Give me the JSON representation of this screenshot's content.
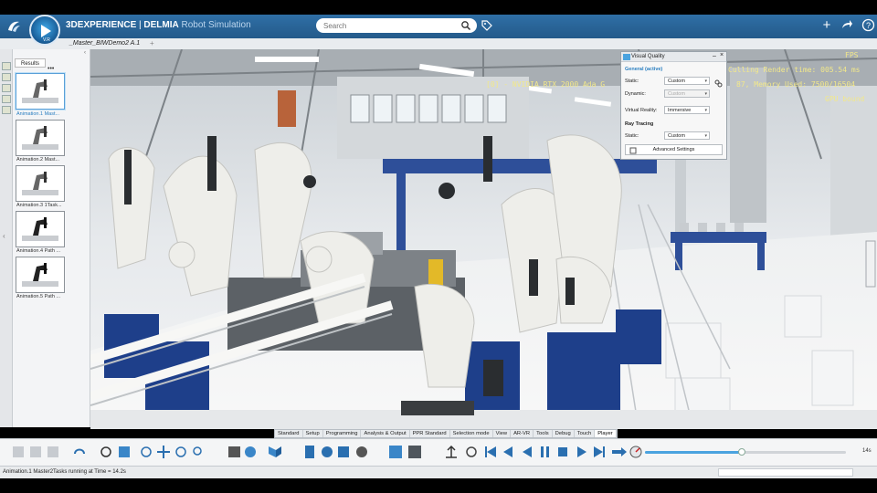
{
  "app": {
    "brand_bold": "3DEXPERIENCE",
    "brand_sep": " | ",
    "brand_product": "DELMIA",
    "brand_app": " Robot Simulation",
    "compass_version": "V.R"
  },
  "search": {
    "placeholder": "Search"
  },
  "document_tab": {
    "label": "_Master_BIWDemo2 A.1"
  },
  "results_panel": {
    "tab_label": "Results",
    "items": [
      {
        "label": "Animation.1 Mast..."
      },
      {
        "label": "Animation.2 Mast..."
      },
      {
        "label": "Animation.3 1Task..."
      },
      {
        "label": "Animation.4 Path ..."
      },
      {
        "label": "Animation.5 Path ..."
      }
    ]
  },
  "visual_quality": {
    "title": "Visual Quality",
    "general_label": "General (active)",
    "static_label": "Static:",
    "static_value": "Custom",
    "dynamic_label": "Dynamic:",
    "dynamic_value": "Custom",
    "vr_label": "Virtual Reality:",
    "vr_value": "Immersive",
    "ray_tracing_label": "Ray Tracing",
    "rt_static_label": "Static:",
    "rt_static_value": "Custom",
    "advanced_button": "Advanced Settings"
  },
  "overlay": {
    "fps": "FPS",
    "culling": "Culling Render time: 005.54 ms",
    "gpu": "[0] - NVIDIA RTX 2000 Ada G",
    "memory": "87, Memory Used: 7500/16504",
    "bound": "GPU bound"
  },
  "section_tabs": [
    {
      "label": "Standard"
    },
    {
      "label": "Setup"
    },
    {
      "label": "Programming"
    },
    {
      "label": "Analysis & Output"
    },
    {
      "label": "PPR Standard"
    },
    {
      "label": "Selection mode"
    },
    {
      "label": "View"
    },
    {
      "label": "AR-VR"
    },
    {
      "label": "Tools"
    },
    {
      "label": "Debug"
    },
    {
      "label": "Touch"
    },
    {
      "label": "Player"
    }
  ],
  "player": {
    "time_readout": "14s",
    "progress_fraction": 0.48
  },
  "status": {
    "text": "Animation.1 Master2Tasks running at Time = 14.2s"
  },
  "colors": {
    "topbar": "#2f6fa6",
    "robot_white": "#eeeeea",
    "pedestal_blue": "#1e3f8a",
    "accent": "#4aa3df",
    "overlay_text": "#f2e88a"
  }
}
